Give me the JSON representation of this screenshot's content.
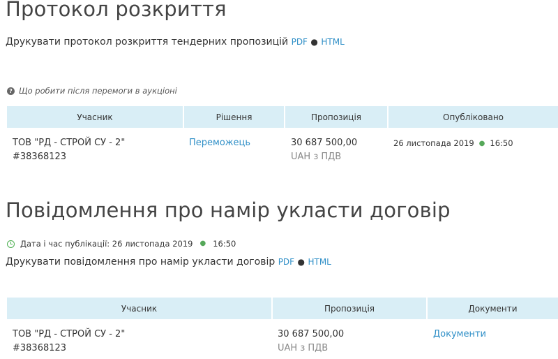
{
  "section1": {
    "title": "Протокол розкриття",
    "print_prefix": "Друкувати протокол розкриття тендерних пропозицій",
    "pdf_link": "PDF",
    "separator": "●",
    "html_link": "HTML",
    "help_link": "Що робити після перемоги в аукціоні",
    "table": {
      "headers": [
        "Учасник",
        "Рішення",
        "Пропозиція",
        "Опубліковано"
      ],
      "rows": [
        {
          "participant_name": "ТОВ \"РД - СТРОЙ СУ - 2\"",
          "participant_id": "#38368123",
          "decision": "Переможець",
          "amount": "30 687 500,00",
          "currency": "UAH з ПДВ",
          "published_date": "26 листопада 2019",
          "published_time": "16:50"
        }
      ]
    }
  },
  "section2": {
    "title": "Повідомлення про намір укласти договір",
    "pub_label": "Дата і час публікації: 26 листопада 2019",
    "pub_time": "16:50",
    "print_prefix": "Друкувати повідомлення про намір укласти договір",
    "pdf_link": "PDF",
    "separator": "●",
    "html_link": "HTML",
    "table": {
      "headers": [
        "Учасник",
        "Пропозиція",
        "Документи"
      ],
      "rows": [
        {
          "participant_name": "ТОВ \"РД - СТРОЙ СУ - 2\"",
          "participant_id": "#38368123",
          "amount": "30 687 500,00",
          "currency": "UAH з ПДВ",
          "documents_link": "Документи"
        }
      ]
    }
  },
  "colors": {
    "link": "#2f8fc7",
    "header_bg": "#d9eef6",
    "accent_green": "#4caf50"
  },
  "icons": {
    "help": "question-circle-icon",
    "clock": "clock-icon"
  }
}
